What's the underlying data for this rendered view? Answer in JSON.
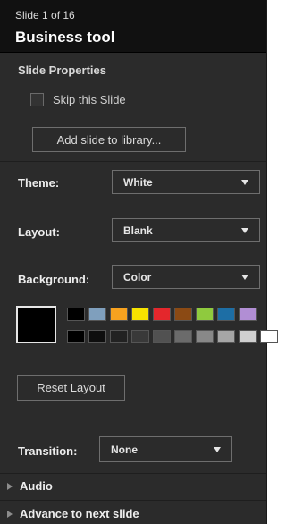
{
  "header": {
    "counter": "Slide 1 of 16",
    "title": "Business tool"
  },
  "slide_properties": {
    "title": "Slide Properties",
    "skip_label": "Skip this Slide",
    "add_to_library_label": "Add slide to library..."
  },
  "theme": {
    "label": "Theme:",
    "value": "White"
  },
  "layout": {
    "label": "Layout:",
    "value": "Blank"
  },
  "background": {
    "label": "Background:",
    "value": "Color",
    "selected_color": "#000000",
    "palette_row1": [
      "#000000",
      "#7f9fbd",
      "#f7a21f",
      "#f6e200",
      "#e4272c",
      "#8b4a14",
      "#8fca3e",
      "#1d6ea5",
      "#b18ed4"
    ],
    "palette_row2": [
      "#000000",
      "#0e0e0e",
      "#222222",
      "#393939",
      "#515151",
      "#6b6b6b",
      "#888888",
      "#a6a6a6",
      "#cfcfcf",
      "#ffffff"
    ]
  },
  "reset_layout_label": "Reset Layout",
  "transition": {
    "label": "Transition:",
    "value": "None"
  },
  "expanders": {
    "audio": "Audio",
    "advance": "Advance to next slide"
  }
}
